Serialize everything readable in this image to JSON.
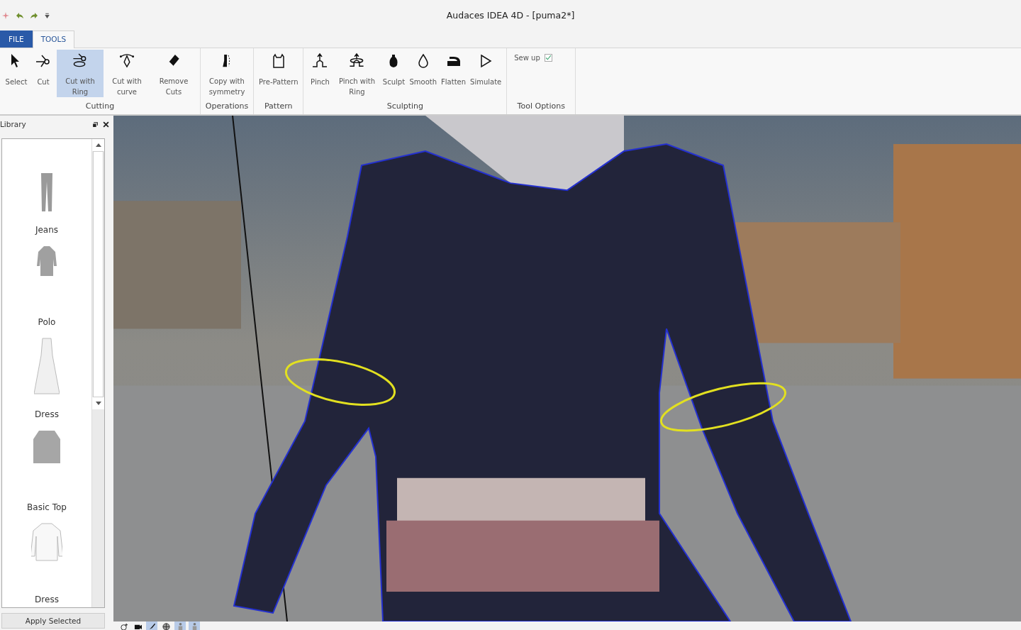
{
  "window": {
    "title": "Audaces IDEA 4D - [puma2*]"
  },
  "tabs": [
    {
      "label": "FILE",
      "kind": "file",
      "selected": false
    },
    {
      "label": "TOOLS",
      "kind": "tab",
      "selected": true
    }
  ],
  "ribbon": {
    "groups": [
      {
        "label": "Cutting",
        "tools": [
          {
            "label": "Select",
            "selected": false
          },
          {
            "label": "Cut",
            "selected": false
          },
          {
            "label": "Cut with Ring",
            "selected": true
          },
          {
            "label": "Cut with curve",
            "selected": false
          },
          {
            "label": "Remove Cuts",
            "selected": false
          }
        ]
      },
      {
        "label": "Operations",
        "tools": [
          {
            "label": "Copy with symmetry",
            "selected": false
          }
        ]
      },
      {
        "label": "Pattern",
        "tools": [
          {
            "label": "Pre-Pattern",
            "selected": false
          }
        ]
      },
      {
        "label": "Sculpting",
        "tools": [
          {
            "label": "Pinch",
            "selected": false
          },
          {
            "label": "Pinch with Ring",
            "selected": false
          },
          {
            "label": "Sculpt",
            "selected": false
          },
          {
            "label": "Smooth",
            "selected": false
          },
          {
            "label": "Flatten",
            "selected": false
          },
          {
            "label": "Simulate",
            "selected": false
          }
        ]
      },
      {
        "label": "Tool Options",
        "options": [
          {
            "label": "Sew up",
            "checked": true
          }
        ]
      }
    ]
  },
  "library": {
    "title": "Library",
    "items": [
      {
        "label": "Jeans"
      },
      {
        "label": "Polo"
      },
      {
        "label": "Dress"
      },
      {
        "label": "Basic Top"
      },
      {
        "label": "Dress"
      }
    ],
    "button": "Apply Selected"
  },
  "bottom_toolbar": [
    {
      "selected": false
    },
    {
      "selected": false
    },
    {
      "selected": true
    },
    {
      "selected": false
    },
    {
      "selected": true
    },
    {
      "selected": true
    }
  ]
}
